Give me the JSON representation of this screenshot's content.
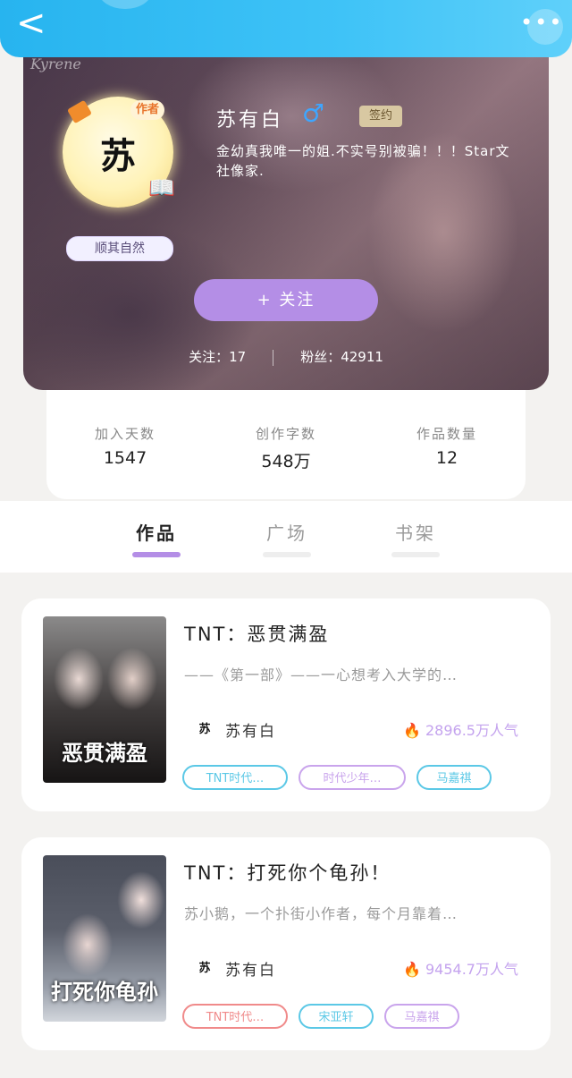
{
  "header": {
    "back_icon": "chevron-left-icon",
    "more_icon": "more-dots-icon",
    "back_glyph": "<",
    "more_glyph": "•••"
  },
  "profile": {
    "watermark": "Kyrene",
    "avatar_char": "苏",
    "author_tag": "作者",
    "motto": "顺其自然",
    "name": "苏有白",
    "gender_glyph": "♂",
    "signed_badge": "签约",
    "bio": "金幼真我唯一的姐.不实号别被骗！！！Star文社像家.",
    "follow_button": "+ 关注",
    "following_label": "关注：17",
    "fans_label": "粉丝：42911"
  },
  "stats": [
    {
      "label": "加入天数",
      "value": "1547"
    },
    {
      "label": "创作字数",
      "value": "548万"
    },
    {
      "label": "作品数量",
      "value": "12"
    }
  ],
  "tabs": [
    {
      "label": "作品",
      "active": true
    },
    {
      "label": "广场",
      "active": false
    },
    {
      "label": "书架",
      "active": false
    }
  ],
  "works": [
    {
      "title": "TNT：恶贯满盈",
      "description": "——《第一部》——一心想考入大学的…",
      "cover_text": "恶贯满盈",
      "author_char": "苏",
      "author": "苏有白",
      "popularity": "2896.5万人气",
      "tags": [
        {
          "label": "TNT时代…",
          "color": "#5bc8e6"
        },
        {
          "label": "时代少年…",
          "color": "#c9a4ec"
        },
        {
          "label": "马嘉祺",
          "color": "#5bc8e6"
        }
      ]
    },
    {
      "title": "TNT：打死你个龟孙！",
      "description": "苏小鹅，一个扑街小作者，每个月靠着…",
      "cover_text": "打死你龟孙",
      "author_char": "苏",
      "author": "苏有白",
      "popularity": "9454.7万人气",
      "tags": [
        {
          "label": "TNT时代…",
          "color": "#f08a8a"
        },
        {
          "label": "宋亚轩",
          "color": "#5bc8e6"
        },
        {
          "label": "马嘉祺",
          "color": "#c9a4ec"
        }
      ]
    }
  ],
  "colors": {
    "top_bar": "#27b4ef",
    "follow_button": "#b48ee6",
    "tab_indicator": "#b48ee6",
    "popularity": "#c4a3ee"
  }
}
